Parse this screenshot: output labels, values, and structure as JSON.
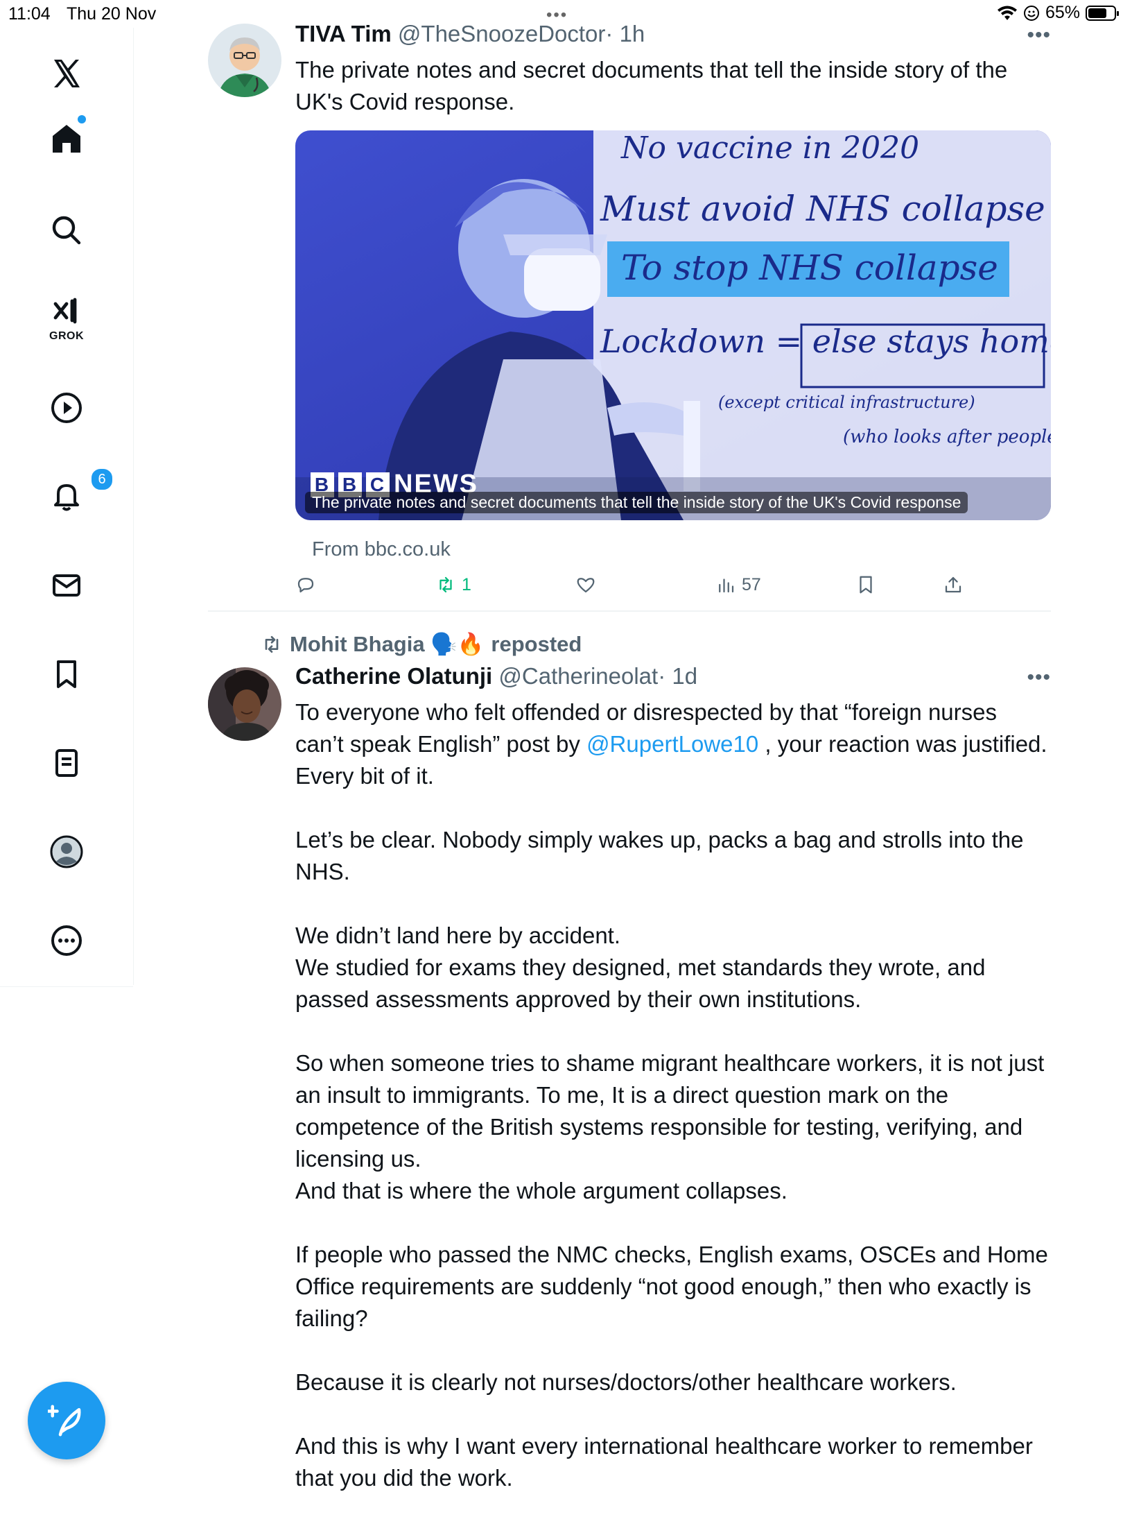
{
  "status_bar": {
    "time": "11:04",
    "date": "Thu 20 Nov",
    "battery": "65%",
    "dots": "•••"
  },
  "sidebar": {
    "grok_label": "GROK",
    "notifications_count": "6"
  },
  "tweet1": {
    "name": "TIVA Tim",
    "handle": "@TheSnoozeDoctor",
    "time": "· 1h",
    "more": "•••",
    "text": "The private notes and secret documents that tell the inside story of the UK's Covid response.",
    "card": {
      "caption": "The private notes and secret documents that tell the inside story of the UK's Covid response",
      "logo_letters": [
        "B",
        "B",
        "C"
      ],
      "logo_word": "NEWS",
      "handwriting": [
        "No vaccine in 2020",
        "Must avoid NHS collapse",
        "To stop NHS collapse",
        "Lockdown = else stays home",
        "(except critical infrastructure)",
        "(who looks after people who can't survive?)"
      ]
    },
    "from": "From bbc.co.uk",
    "actions": {
      "reposts": "1",
      "views": "57"
    }
  },
  "tweet2": {
    "reposted_by": "Mohit Bhagia 🗣️🔥",
    "reposted_word": "reposted",
    "name": "Catherine Olatunji",
    "handle": "@Catherineolat",
    "time": "· 1d",
    "more": "•••",
    "p1_a": "To everyone who felt offended or disrespected by that “foreign nurses can’t speak English” post by ",
    "p1_mention": "@RupertLowe10",
    "p1_b": " , your reaction was justified. Every bit of it.",
    "p2": "Let’s be clear. Nobody simply wakes up, packs a bag and strolls into the NHS.",
    "p3_a": "We didn’t land here by accident.",
    "p3_b": "We studied for exams they designed, met standards they wrote, and passed assessments approved by their own institutions.",
    "p4_a": "So when someone tries to shame migrant healthcare workers, it is not just an insult to immigrants. To me, It is a direct question mark on the competence of the British systems responsible for testing, verifying, and licensing us.",
    "p4_b": "And that is where the whole argument collapses.",
    "p5": "If people who passed the NMC checks, English exams, OSCEs and Home Office requirements are suddenly “not good enough,” then who exactly is failing?",
    "p6": "Because it is clearly not nurses/doctors/other healthcare workers.",
    "p7": "And this is why I want every international healthcare worker to remember that you did the work."
  },
  "colors": {
    "accent": "#1d9bf0",
    "repost_green": "#00ba7c",
    "muted": "#536471"
  }
}
